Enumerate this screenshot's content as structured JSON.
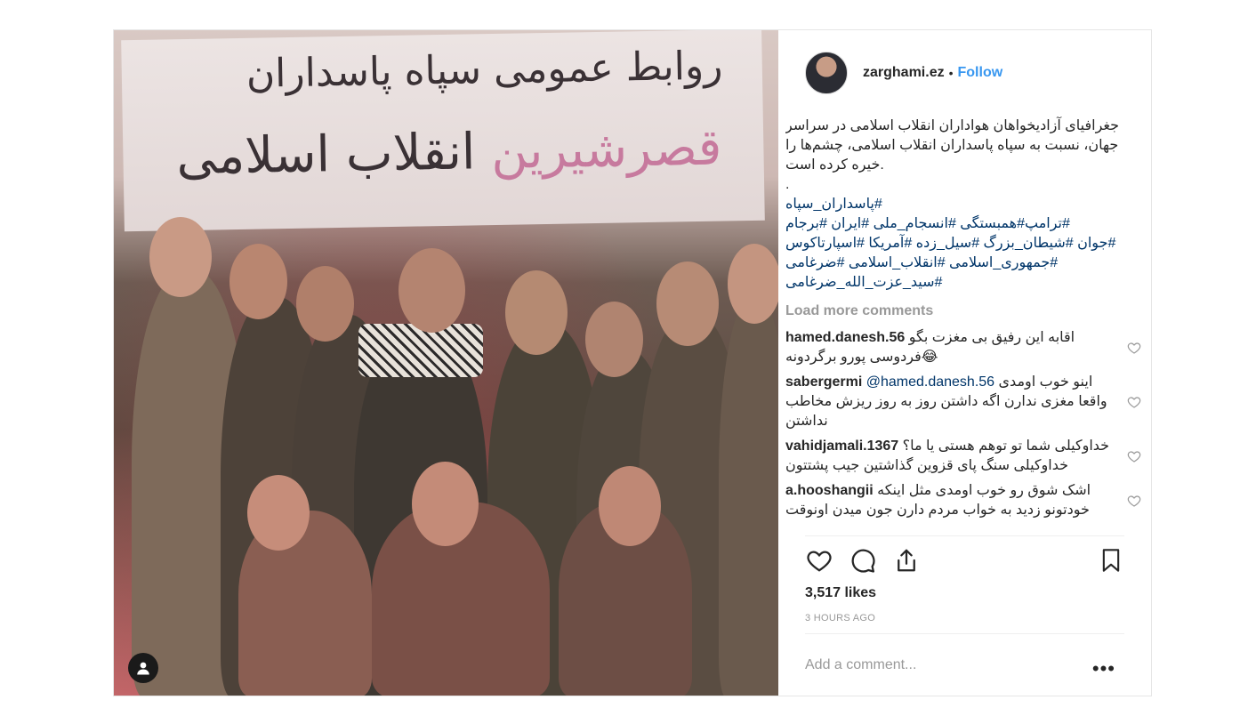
{
  "photo": {
    "banner_line1": "روابط عمومی سپاه پاسداران",
    "banner_line2_a": "انقلاب اسلامی",
    "banner_line2_b": "قصرشیرین"
  },
  "header": {
    "username": "zarghami.ez",
    "separator": "•",
    "follow_label": "Follow"
  },
  "caption": {
    "line1": "جغرافیای آزادیخواهان هواداران انقلاب اسلامی در سراسر",
    "line2": "جهان، نسبت به سپاه پاسداران انقلاب اسلامی، چشم‌ها را",
    "line3": ".خیره کرده است",
    "line4": ".",
    "hashtags": [
      "#پاسداران_سپاه",
      "#ترامپ#همبستگی #انسجام_ملی #ایران   #برجام",
      "#جوان  #شیطان_بزرگ  #سیل_زده #آمریکا #اسپارتاکوس",
      "#جمهوری_اسلامی #انقلاب_اسلامی  #ضرغامی",
      "#سید_عزت_الله_ضرغامی"
    ]
  },
  "load_more": "Load more comments",
  "comments": [
    {
      "author": "hamed.danesh.56",
      "mention": "",
      "text": "اقابه این رفیق بی مغزت بگو فردوسی پورو برگردونه😂"
    },
    {
      "author": "sabergermi",
      "mention": "@hamed.danesh.56",
      "text": "اینو خوب اومدی واقعا مغزی ندارن اگه داشتن روز به روز ریزش مخاطب نداشتن"
    },
    {
      "author": "vahidjamali.1367",
      "mention": "",
      "text": "خداوکیلی شما تو توهم هستی یا ما؟خداوکیلی سنگ پای قزوین گذاشتین جیب پشتتون"
    },
    {
      "author": "a.hooshangii",
      "mention": "",
      "text": "اشک شوق رو خوب اومدی مثل اینکه خودتونو زدید به خواب مردم دارن جون میدن اونوقت"
    }
  ],
  "likes": "3,517 likes",
  "timestamp": "3 HOURS AGO",
  "add_comment_placeholder": "Add a comment...",
  "more_label": "•••",
  "icons": [
    "heart-icon",
    "comment-icon",
    "share-icon",
    "bookmark-icon",
    "user-tag-icon",
    "more-icon"
  ]
}
